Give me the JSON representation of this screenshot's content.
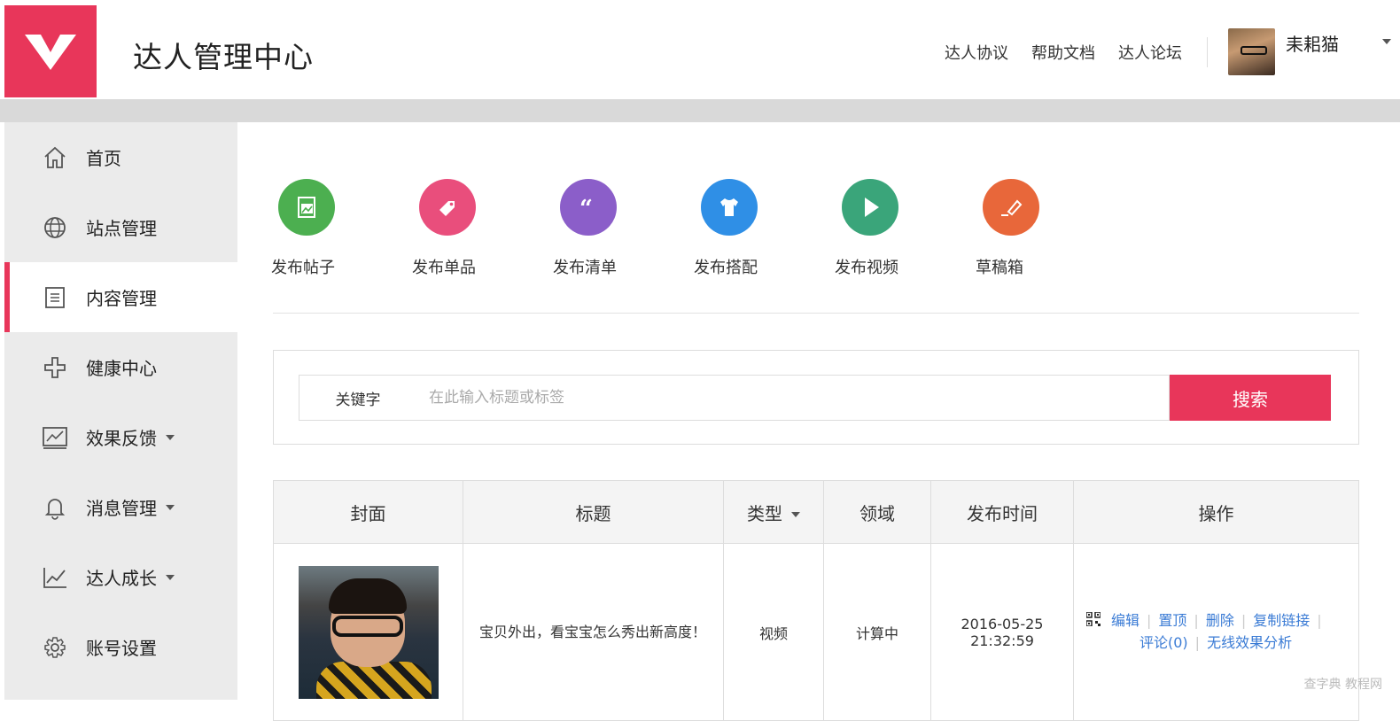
{
  "header": {
    "app_title": "达人管理中心",
    "links": [
      "达人协议",
      "帮助文档",
      "达人论坛"
    ],
    "username": "耒耜猫"
  },
  "sidebar": {
    "items": [
      {
        "label": "首页",
        "icon": "home-icon"
      },
      {
        "label": "站点管理",
        "icon": "globe-icon"
      },
      {
        "label": "内容管理",
        "icon": "document-icon",
        "active": true
      },
      {
        "label": "健康中心",
        "icon": "plus-icon"
      },
      {
        "label": "效果反馈",
        "icon": "chart-icon",
        "dropdown": true
      },
      {
        "label": "消息管理",
        "icon": "bell-icon",
        "dropdown": true
      },
      {
        "label": "达人成长",
        "icon": "growth-icon",
        "dropdown": true
      },
      {
        "label": "账号设置",
        "icon": "gear-icon"
      }
    ]
  },
  "quick_actions": [
    {
      "label": "发布帖子",
      "color": "#4caf50",
      "icon": "image-icon"
    },
    {
      "label": "发布单品",
      "color": "#e94e7c",
      "icon": "tag-icon"
    },
    {
      "label": "发布清单",
      "color": "#8b5ec9",
      "icon": "quote-icon"
    },
    {
      "label": "发布搭配",
      "color": "#2f8fe6",
      "icon": "tshirt-icon"
    },
    {
      "label": "发布视频",
      "color": "#3aa57a",
      "icon": "play-icon"
    },
    {
      "label": "草稿箱",
      "color": "#e8673a",
      "icon": "eraser-icon"
    }
  ],
  "search": {
    "label": "关键字",
    "placeholder": "在此输入标题或标签",
    "button": "搜索"
  },
  "table": {
    "headers": [
      "封面",
      "标题",
      "类型",
      "领域",
      "发布时间",
      "操作"
    ],
    "rows": [
      {
        "title": "宝贝外出，看宝宝怎么秀出新高度！",
        "type": "视频",
        "domain": "计算中",
        "date": "2016-05-25",
        "time": "21:32:59",
        "actions": [
          "编辑",
          "置顶",
          "删除",
          "复制链接",
          "评论(0)",
          "无线效果分析"
        ]
      }
    ]
  },
  "watermark": "查字典 教程网",
  "colors": {
    "accent": "#e8365a",
    "link": "#3a7bd5"
  }
}
